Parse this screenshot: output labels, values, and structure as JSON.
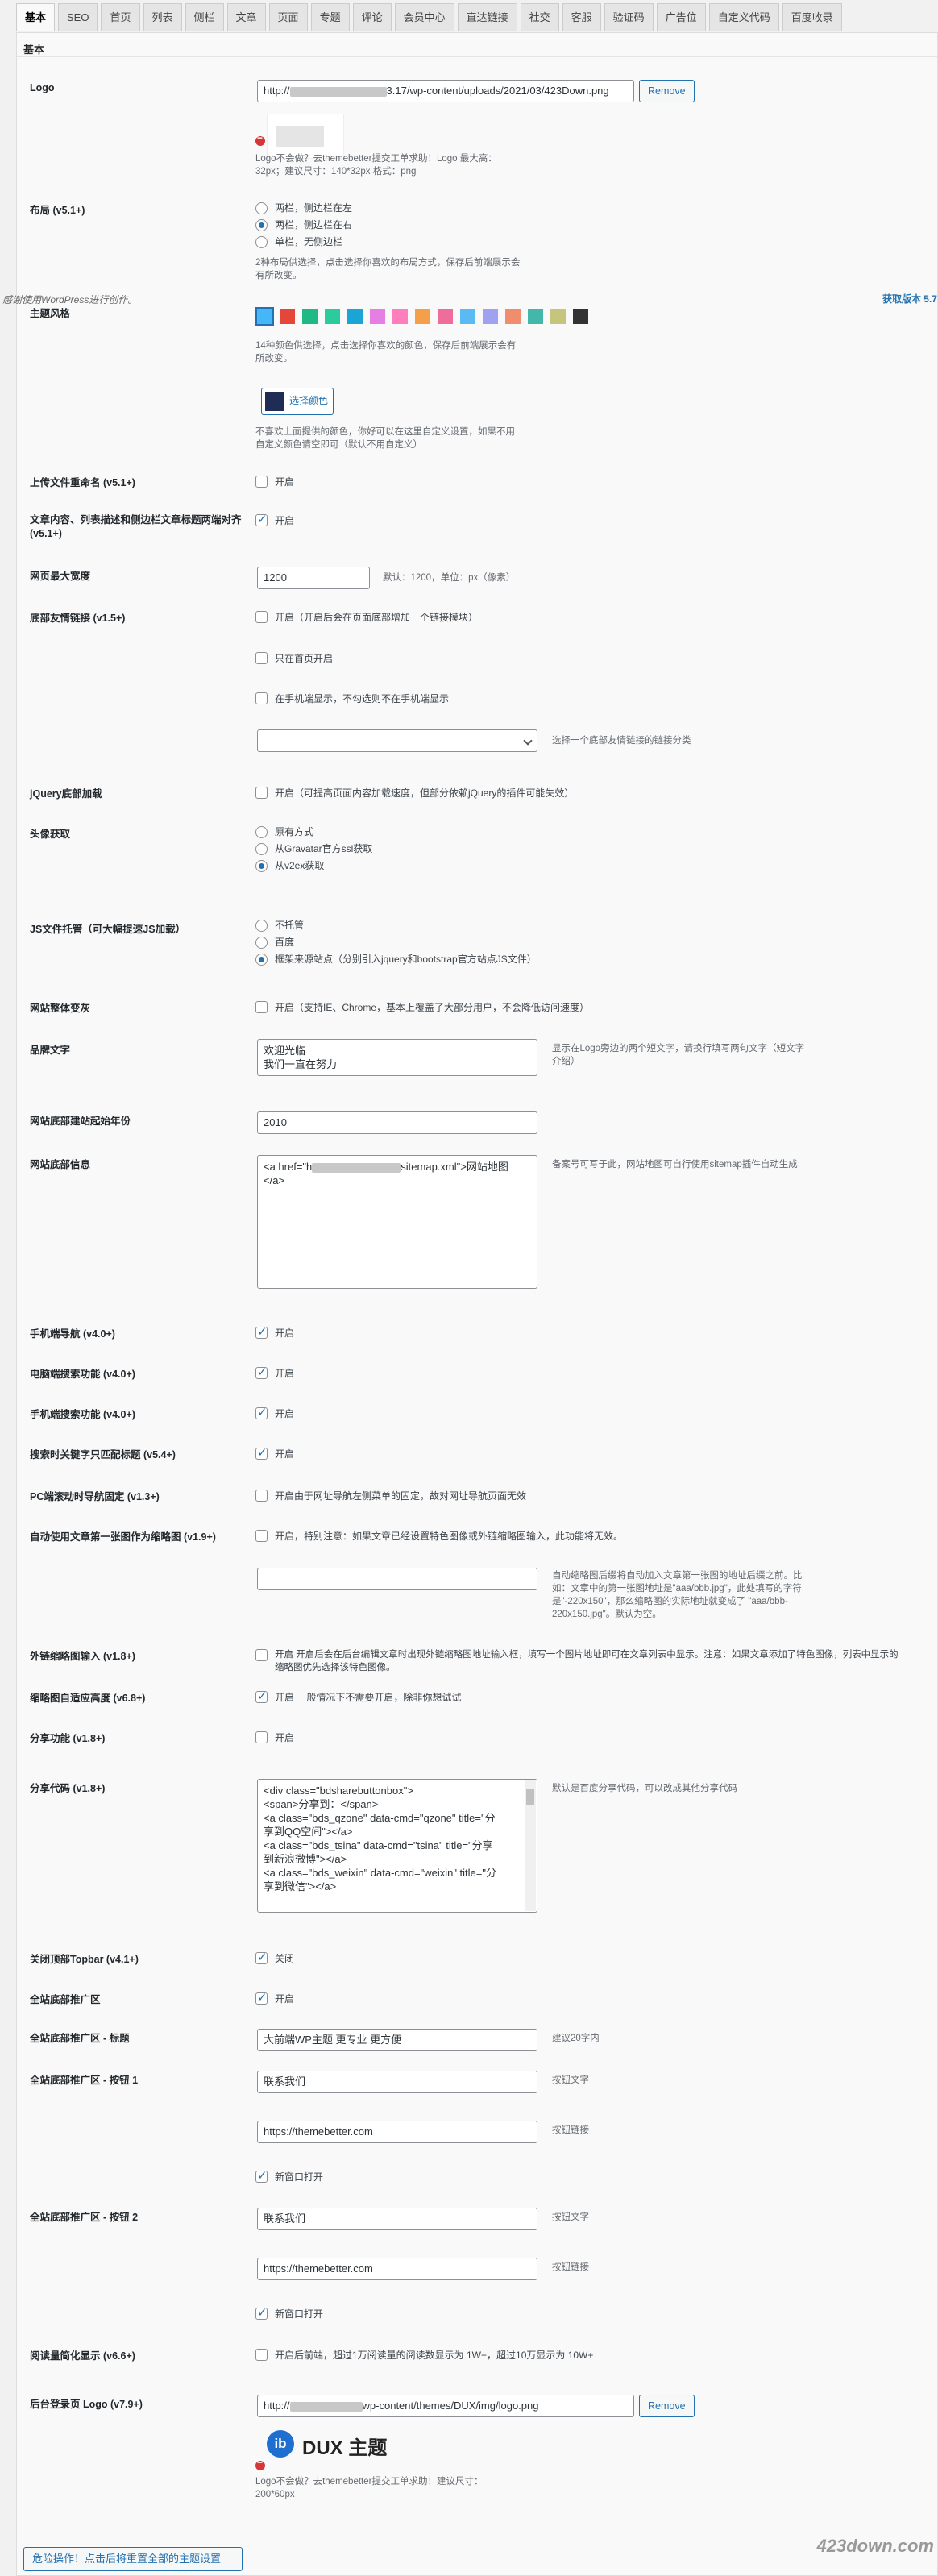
{
  "tabs": [
    "基本",
    "SEO",
    "首页",
    "列表",
    "侧栏",
    "文章",
    "页面",
    "专题",
    "评论",
    "会员中心",
    "直达链接",
    "社交",
    "客服",
    "验证码",
    "广告位",
    "自定义代码",
    "百度收录"
  ],
  "section": "基本",
  "notice": "感谢使用WordPress进行创作。",
  "version": "获取版本 5.7",
  "colors": {
    "swatches": [
      "#45b6f7",
      "#e4463a",
      "#1fb985",
      "#2bcb9b",
      "#1aa5d6",
      "#e67ee4",
      "#ff7fbd",
      "#f4a04a",
      "#ee6d9a",
      "#5bb9f3",
      "#a1a1f2",
      "#ef8d6e",
      "#45b6aa",
      "#c6c57e",
      "#333333"
    ],
    "picked": "#1f2d56",
    "accent": "#2271b1"
  },
  "logo": {
    "label": "Logo",
    "url_prefix": "http://",
    "url_suffix": "3.17/wp-content/uploads/2021/03/423Down.png",
    "remove": "Remove",
    "desc": "Logo不会做？去themebetter提交工单求助！Logo 最大高：32px；建议尺寸：140*32px 格式：png"
  },
  "layout": {
    "label": "布局 (v5.1+)",
    "options": [
      "两栏，侧边栏在左",
      "两栏，侧边栏在右",
      "单栏，无侧边栏"
    ],
    "selected": 1,
    "desc": "2种布局供选择，点击选择你喜欢的布局方式，保存后前端展示会有所改变。"
  },
  "theme_color": {
    "label": "主题风格",
    "desc": "14种颜色供选择，点击选择你喜欢的颜色，保存后前端展示会有所改变。",
    "pick": "选择颜色",
    "pick_desc": "不喜欢上面提供的颜色，你好可以在这里自定义设置，如果不用自定义颜色请空即可（默认不用自定义）"
  },
  "rename": {
    "label": "上传文件重命名 (v5.1+)",
    "text": "开启"
  },
  "align": {
    "label": "文章内容、列表描述和侧边栏文章标题两端对齐 (v5.1+)",
    "text": "开启"
  },
  "maxwidth": {
    "label": "网页最大宽度",
    "value": "1200",
    "desc": "默认：1200，单位：px（像素）"
  },
  "friendlinks": {
    "label": "底部友情链接 (v1.5+)",
    "opt1": "开启（开启后会在页面底部增加一个链接模块）",
    "opt2": "只在首页开启",
    "opt3": "在手机端显示，不勾选则不在手机端显示",
    "select_desc": "选择一个底部友情链接的链接分类"
  },
  "jquery": {
    "label": "jQuery底部加载",
    "text": "开启（可提高页面内容加载速度，但部分依赖jQuery的插件可能失效）"
  },
  "avatar": {
    "label": "头像获取",
    "options": [
      "原有方式",
      "从Gravatar官方ssl获取",
      "从v2ex获取"
    ],
    "selected": 2
  },
  "jshost": {
    "label": "JS文件托管（可大幅提速JS加载）",
    "options": [
      "不托管",
      "百度",
      "框架来源站点（分别引入jquery和bootstrap官方站点JS文件）"
    ],
    "selected": 2
  },
  "grayscale": {
    "label": "网站整体变灰",
    "text": "开启（支持IE、Chrome，基本上覆盖了大部分用户，不会降低访问速度）"
  },
  "brand": {
    "label": "品牌文字",
    "lines": [
      "欢迎光临",
      "我们一直在努力"
    ],
    "desc": "显示在Logo旁边的两个短文字，请换行填写两句文字（短文字介绍）"
  },
  "since": {
    "label": "网站底部建站起始年份",
    "value": "2010"
  },
  "footer": {
    "label": "网站底部信息",
    "code_a": "<a href=\"h",
    "code_b": "sitemap.xml\">网站地图",
    "code_c": "</a>",
    "desc": "备案号可写于此，网站地图可自行使用sitemap插件自动生成"
  },
  "m_nav": {
    "label": "手机端导航 (v4.0+)",
    "text": "开启"
  },
  "pc_search": {
    "label": "电脑端搜索功能 (v4.0+)",
    "text": "开启"
  },
  "m_search": {
    "label": "手机端搜索功能 (v4.0+)",
    "text": "开启"
  },
  "search_match": {
    "label": "搜索时关键字只匹配标题 (v5.4+)",
    "text": "开启"
  },
  "pc_scroll": {
    "label": "PC端滚动时导航固定 (v1.3+)",
    "text": "开启由于网址导航左侧菜单的固定，故对网址导航页面无效"
  },
  "auto_thumb": {
    "label": "自动使用文章第一张图作为缩略图 (v1.9+)",
    "text": "开启，特别注意：如果文章已经设置特色图像或外链缩略图输入，此功能将无效。",
    "desc": "自动缩略图后缀将自动加入文章第一张图的地址后缀之前。比如：文章中的第一张图地址是\"aaa/bbb.jpg\"，此处填写的字符是\"-220x150\"，那么缩略图的实际地址就变成了 \"aaa/bbb-220x150.jpg\"。默认为空。"
  },
  "ext_thumb": {
    "label": "外链缩略图输入 (v1.8+)",
    "text": "开启 开启后会在后台编辑文章时出现外链缩略图地址输入框，填写一个图片地址即可在文章列表中显示。注意：如果文章添加了特色图像，列表中显示的缩略图优先选择该特色图像。"
  },
  "thumb_height": {
    "label": "缩略图自适应高度 (v6.8+)",
    "text": "开启 一般情况下不需要开启，除非你想试试"
  },
  "share": {
    "label": "分享功能 (v1.8+)",
    "text": "开启"
  },
  "share_code": {
    "label": "分享代码 (v1.8+)",
    "lines": [
      "<div class=\"bdsharebuttonbox\">",
      "<span>分享到：</span>",
      "<a class=\"bds_qzone\" data-cmd=\"qzone\" title=\"分",
      "享到QQ空间\"></a>",
      "<a class=\"bds_tsina\" data-cmd=\"tsina\" title=\"分享",
      "到新浪微博\"></a>",
      "<a class=\"bds_weixin\" data-cmd=\"weixin\" title=\"分",
      "享到微信\"></a>"
    ],
    "desc": "默认是百度分享代码，可以改成其他分享代码"
  },
  "topbar": {
    "label": "关闭顶部Topbar (v4.1+)",
    "text": "关闭"
  },
  "promo": {
    "label": "全站底部推广区",
    "text": "开启"
  },
  "promo_title": {
    "label": "全站底部推广区 - 标题",
    "value": "大前端WP主题 更专业 更方便",
    "desc": "建议20字内"
  },
  "btn1": {
    "label": "全站底部推广区 - 按钮 1",
    "text": "联系我们",
    "text_desc": "按钮文字",
    "link": "https://themebetter.com",
    "link_desc": "按钮链接",
    "newwin": "新窗口打开"
  },
  "btn2": {
    "label": "全站底部推广区 - 按钮 2",
    "text": "联系我们",
    "text_desc": "按钮文字",
    "link": "https://themebetter.com",
    "link_desc": "按钮链接",
    "newwin": "新窗口打开"
  },
  "readcount": {
    "label": "阅读量简化显示 (v6.6+)",
    "text": "开启后前端，超过1万阅读量的阅读数显示为 1W+，超过10万显示为 10W+"
  },
  "login_logo": {
    "label": "后台登录页 Logo (v7.9+)",
    "url_prefix": "http://",
    "url_suffix": "wp-content/themes/DUX/img/logo.png",
    "remove": "Remove",
    "brand": "DUX 主题",
    "desc": "Logo不会做？去themebetter提交工单求助！建议尺寸：200*60px"
  },
  "danger": "危险操作！点击后将重置全部的主题设置",
  "watermark": "423down.com"
}
